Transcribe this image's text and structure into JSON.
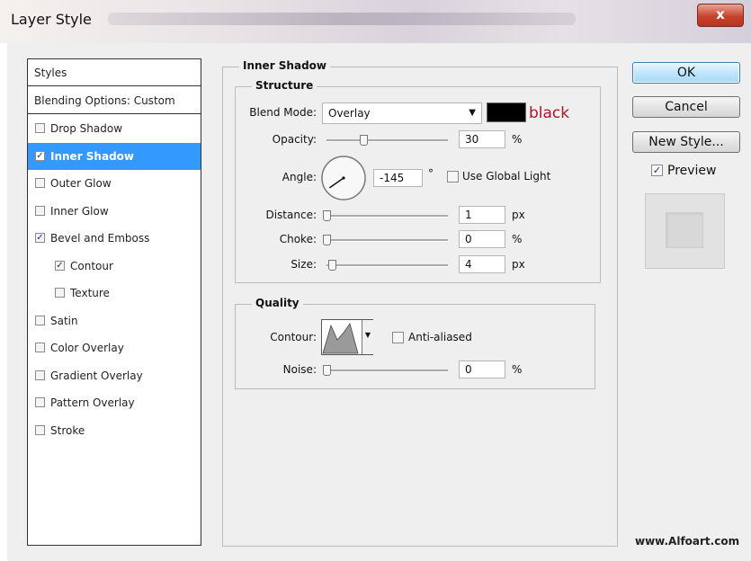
{
  "window": {
    "title": "Layer Style",
    "close_glyph": "x"
  },
  "styles_list": {
    "header": "Styles",
    "blending": "Blending Options: Custom",
    "items": [
      {
        "label": "Drop Shadow",
        "checked": false,
        "indent": false,
        "selected": false
      },
      {
        "label": "Inner Shadow",
        "checked": true,
        "indent": false,
        "selected": true
      },
      {
        "label": "Outer Glow",
        "checked": false,
        "indent": false,
        "selected": false
      },
      {
        "label": "Inner Glow",
        "checked": false,
        "indent": false,
        "selected": false
      },
      {
        "label": "Bevel and Emboss",
        "checked": true,
        "indent": false,
        "selected": false
      },
      {
        "label": "Contour",
        "checked": true,
        "indent": true,
        "selected": false
      },
      {
        "label": "Texture",
        "checked": false,
        "indent": true,
        "selected": false
      },
      {
        "label": "Satin",
        "checked": false,
        "indent": false,
        "selected": false
      },
      {
        "label": "Color Overlay",
        "checked": false,
        "indent": false,
        "selected": false
      },
      {
        "label": "Gradient Overlay",
        "checked": false,
        "indent": false,
        "selected": false
      },
      {
        "label": "Pattern Overlay",
        "checked": false,
        "indent": false,
        "selected": false
      },
      {
        "label": "Stroke",
        "checked": false,
        "indent": false,
        "selected": false
      }
    ]
  },
  "inner_shadow": {
    "section_title": "Inner Shadow",
    "structure_title": "Structure",
    "blend_mode_label": "Blend Mode:",
    "blend_mode_value": "Overlay",
    "color_annotation": "black",
    "shadow_color": "#000000",
    "annotation_color": "#b0142a",
    "opacity_label": "Opacity:",
    "opacity_value": "30",
    "opacity_unit": "%",
    "opacity_level": 0.3,
    "angle_label": "Angle:",
    "angle_value": "-145",
    "angle_unit": "°",
    "angle_degrees": -145,
    "global_light_label": "Use Global Light",
    "global_light_checked": false,
    "distance_label": "Distance:",
    "distance_value": "1",
    "distance_unit": "px",
    "choke_label": "Choke:",
    "choke_value": "0",
    "choke_unit": "%",
    "size_label": "Size:",
    "size_value": "4",
    "size_unit": "px",
    "quality_title": "Quality",
    "contour_label": "Contour:",
    "anti_aliased_label": "Anti-aliased",
    "anti_aliased_checked": false,
    "noise_label": "Noise:",
    "noise_value": "0",
    "noise_unit": "%"
  },
  "buttons": {
    "ok": "OK",
    "cancel": "Cancel",
    "new_style": "New Style...",
    "preview_label": "Preview",
    "preview_checked": true
  },
  "watermark": "www.Alfoart.com",
  "check_glyph": "✓",
  "dropdown_glyph": "▼"
}
